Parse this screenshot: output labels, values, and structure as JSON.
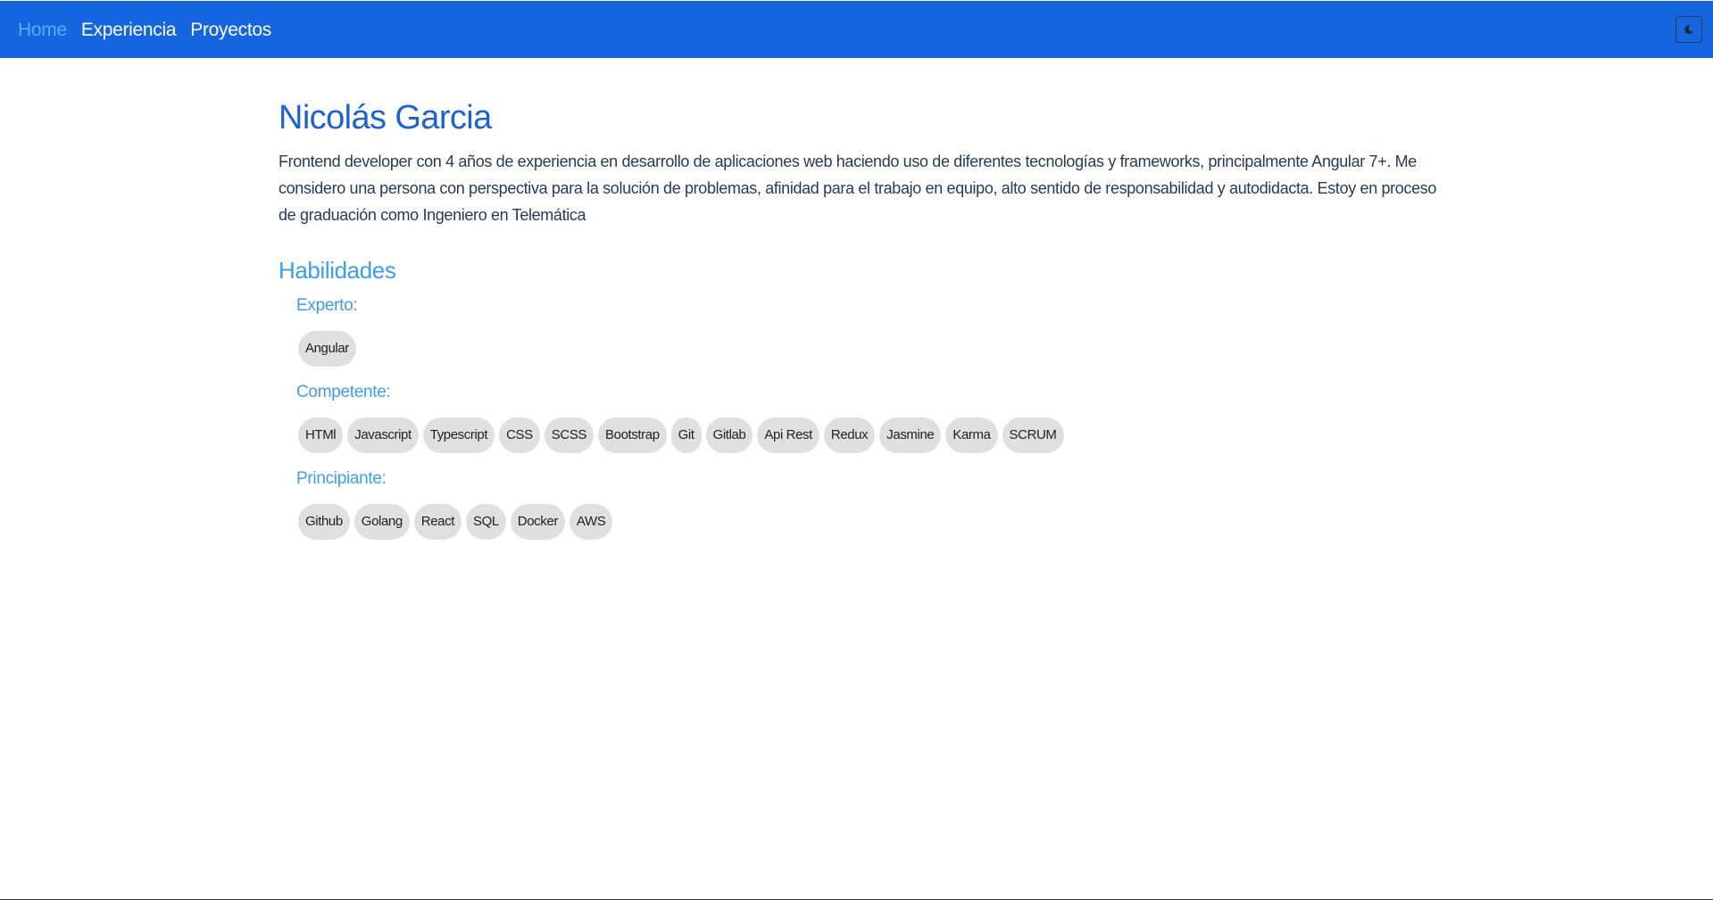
{
  "nav": {
    "links": [
      "Home",
      "Experiencia",
      "Proyectos"
    ],
    "active": "Home",
    "theme_toggle_icon": "moon-icon"
  },
  "profile": {
    "name": "Nicolás Garcia",
    "bio": "Frontend developer con 4 años de experiencia en desarrollo de aplicaciones web haciendo uso de diferentes tecnologías y frameworks, principalmente Angular 7+. Me considero una persona con perspectiva para la solución de problemas, afinidad para el trabajo en equipo, alto sentido de responsabilidad y autodidacta. Estoy en proceso de graduación como Ingeniero en Telemática"
  },
  "skills": {
    "title": "Habilidades",
    "groups": [
      {
        "label": "Experto:",
        "items": [
          "Angular"
        ]
      },
      {
        "label": "Competente:",
        "items": [
          "HTMl",
          "Javascript",
          "Typescript",
          "CSS",
          "SCSS",
          "Bootstrap",
          "Git",
          "Gitlab",
          "Api Rest",
          "Redux",
          "Jasmine",
          "Karma",
          "SCRUM"
        ]
      },
      {
        "label": "Principiante:",
        "items": [
          "Github",
          "Golang",
          "React",
          "SQL",
          "Docker",
          "AWS"
        ]
      }
    ]
  },
  "colors": {
    "navbar": "#1565e0",
    "active_link": "#5aaef5",
    "name": "#1a63d6",
    "section_title": "#3d9df0",
    "chip_bg": "#e0e0e0"
  }
}
